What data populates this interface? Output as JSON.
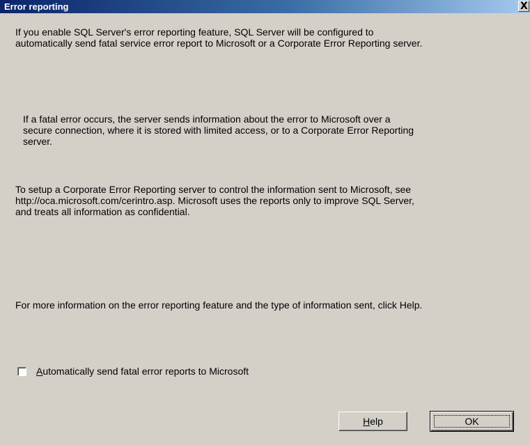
{
  "window": {
    "title": "Error reporting",
    "close_glyph": "X"
  },
  "body": {
    "paragraph1": "If you enable SQL Server's error reporting feature, SQL Server will be configured to\nautomatically send fatal service error report to Microsoft or a Corporate Error Reporting server.",
    "paragraph2": "If a fatal error occurs, the server sends information about the error to Microsoft over a\nsecure connection, where it is stored with limited access, or to a Corporate Error Reporting\nserver.",
    "paragraph3": "To setup a Corporate Error Reporting server to control the information sent to Microsoft, see\nhttp://oca.microsoft.com/cerintro.asp. Microsoft uses the reports only to improve SQL Server,\nand treats all information as confidential.",
    "paragraph4": "For more information on the error reporting feature and the type of information sent, click Help."
  },
  "checkbox": {
    "mnemonic": "A",
    "label_rest": "utomatically send fatal error reports to Microsoft",
    "checked": false
  },
  "buttons": {
    "help_mnemonic": "H",
    "help_rest": "elp",
    "ok_label": "OK"
  },
  "colors": {
    "face": "#d4d0c8",
    "title_start": "#0a246a",
    "title_end": "#a6caf0"
  },
  "icons": {
    "close": "close-icon"
  }
}
